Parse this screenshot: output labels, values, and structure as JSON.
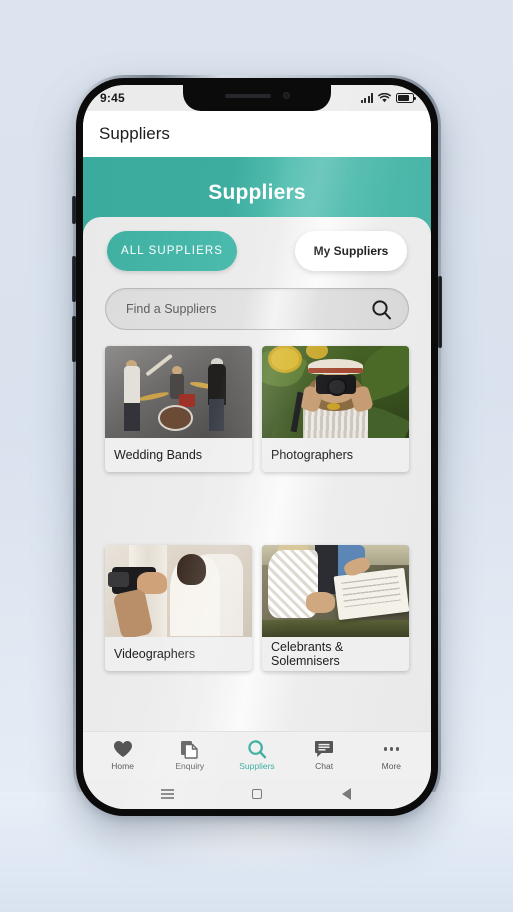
{
  "statusbar": {
    "time": "9:45",
    "signal_icon": "signal-bars-icon",
    "wifi_icon": "wifi-icon",
    "battery_icon": "battery-icon"
  },
  "appbar": {
    "title": "Suppliers"
  },
  "header": {
    "title": "Suppliers",
    "accent_color": "#3fb0a2"
  },
  "tabs": [
    {
      "label": "ALL SUPPLIERS",
      "active": true
    },
    {
      "label": "My Suppliers",
      "active": false
    }
  ],
  "search": {
    "placeholder": "Find a Suppliers",
    "value": "",
    "icon": "search-icon"
  },
  "categories": [
    {
      "label": "Wedding Bands",
      "image": "live-band-performing-photo"
    },
    {
      "label": "Photographers",
      "image": "woman-with-camera-in-sunflower-field-photo"
    },
    {
      "label": "Videographers",
      "image": "videographer-filming-bride-photo"
    },
    {
      "label": "Celebrants & Solemnisers",
      "image": "couple-signing-marriage-register-photo"
    }
  ],
  "bottom_nav": [
    {
      "label": "Home",
      "icon": "heart-icon",
      "active": false
    },
    {
      "label": "Enquiry",
      "icon": "documents-icon",
      "active": false
    },
    {
      "label": "Suppliers",
      "icon": "search-icon",
      "active": true
    },
    {
      "label": "Chat",
      "icon": "chat-bubble-icon",
      "active": false
    },
    {
      "label": "More",
      "icon": "more-dots-icon",
      "active": false
    }
  ],
  "android_nav": [
    {
      "icon": "recents-menu-icon"
    },
    {
      "icon": "home-square-icon"
    },
    {
      "icon": "back-triangle-icon"
    }
  ]
}
